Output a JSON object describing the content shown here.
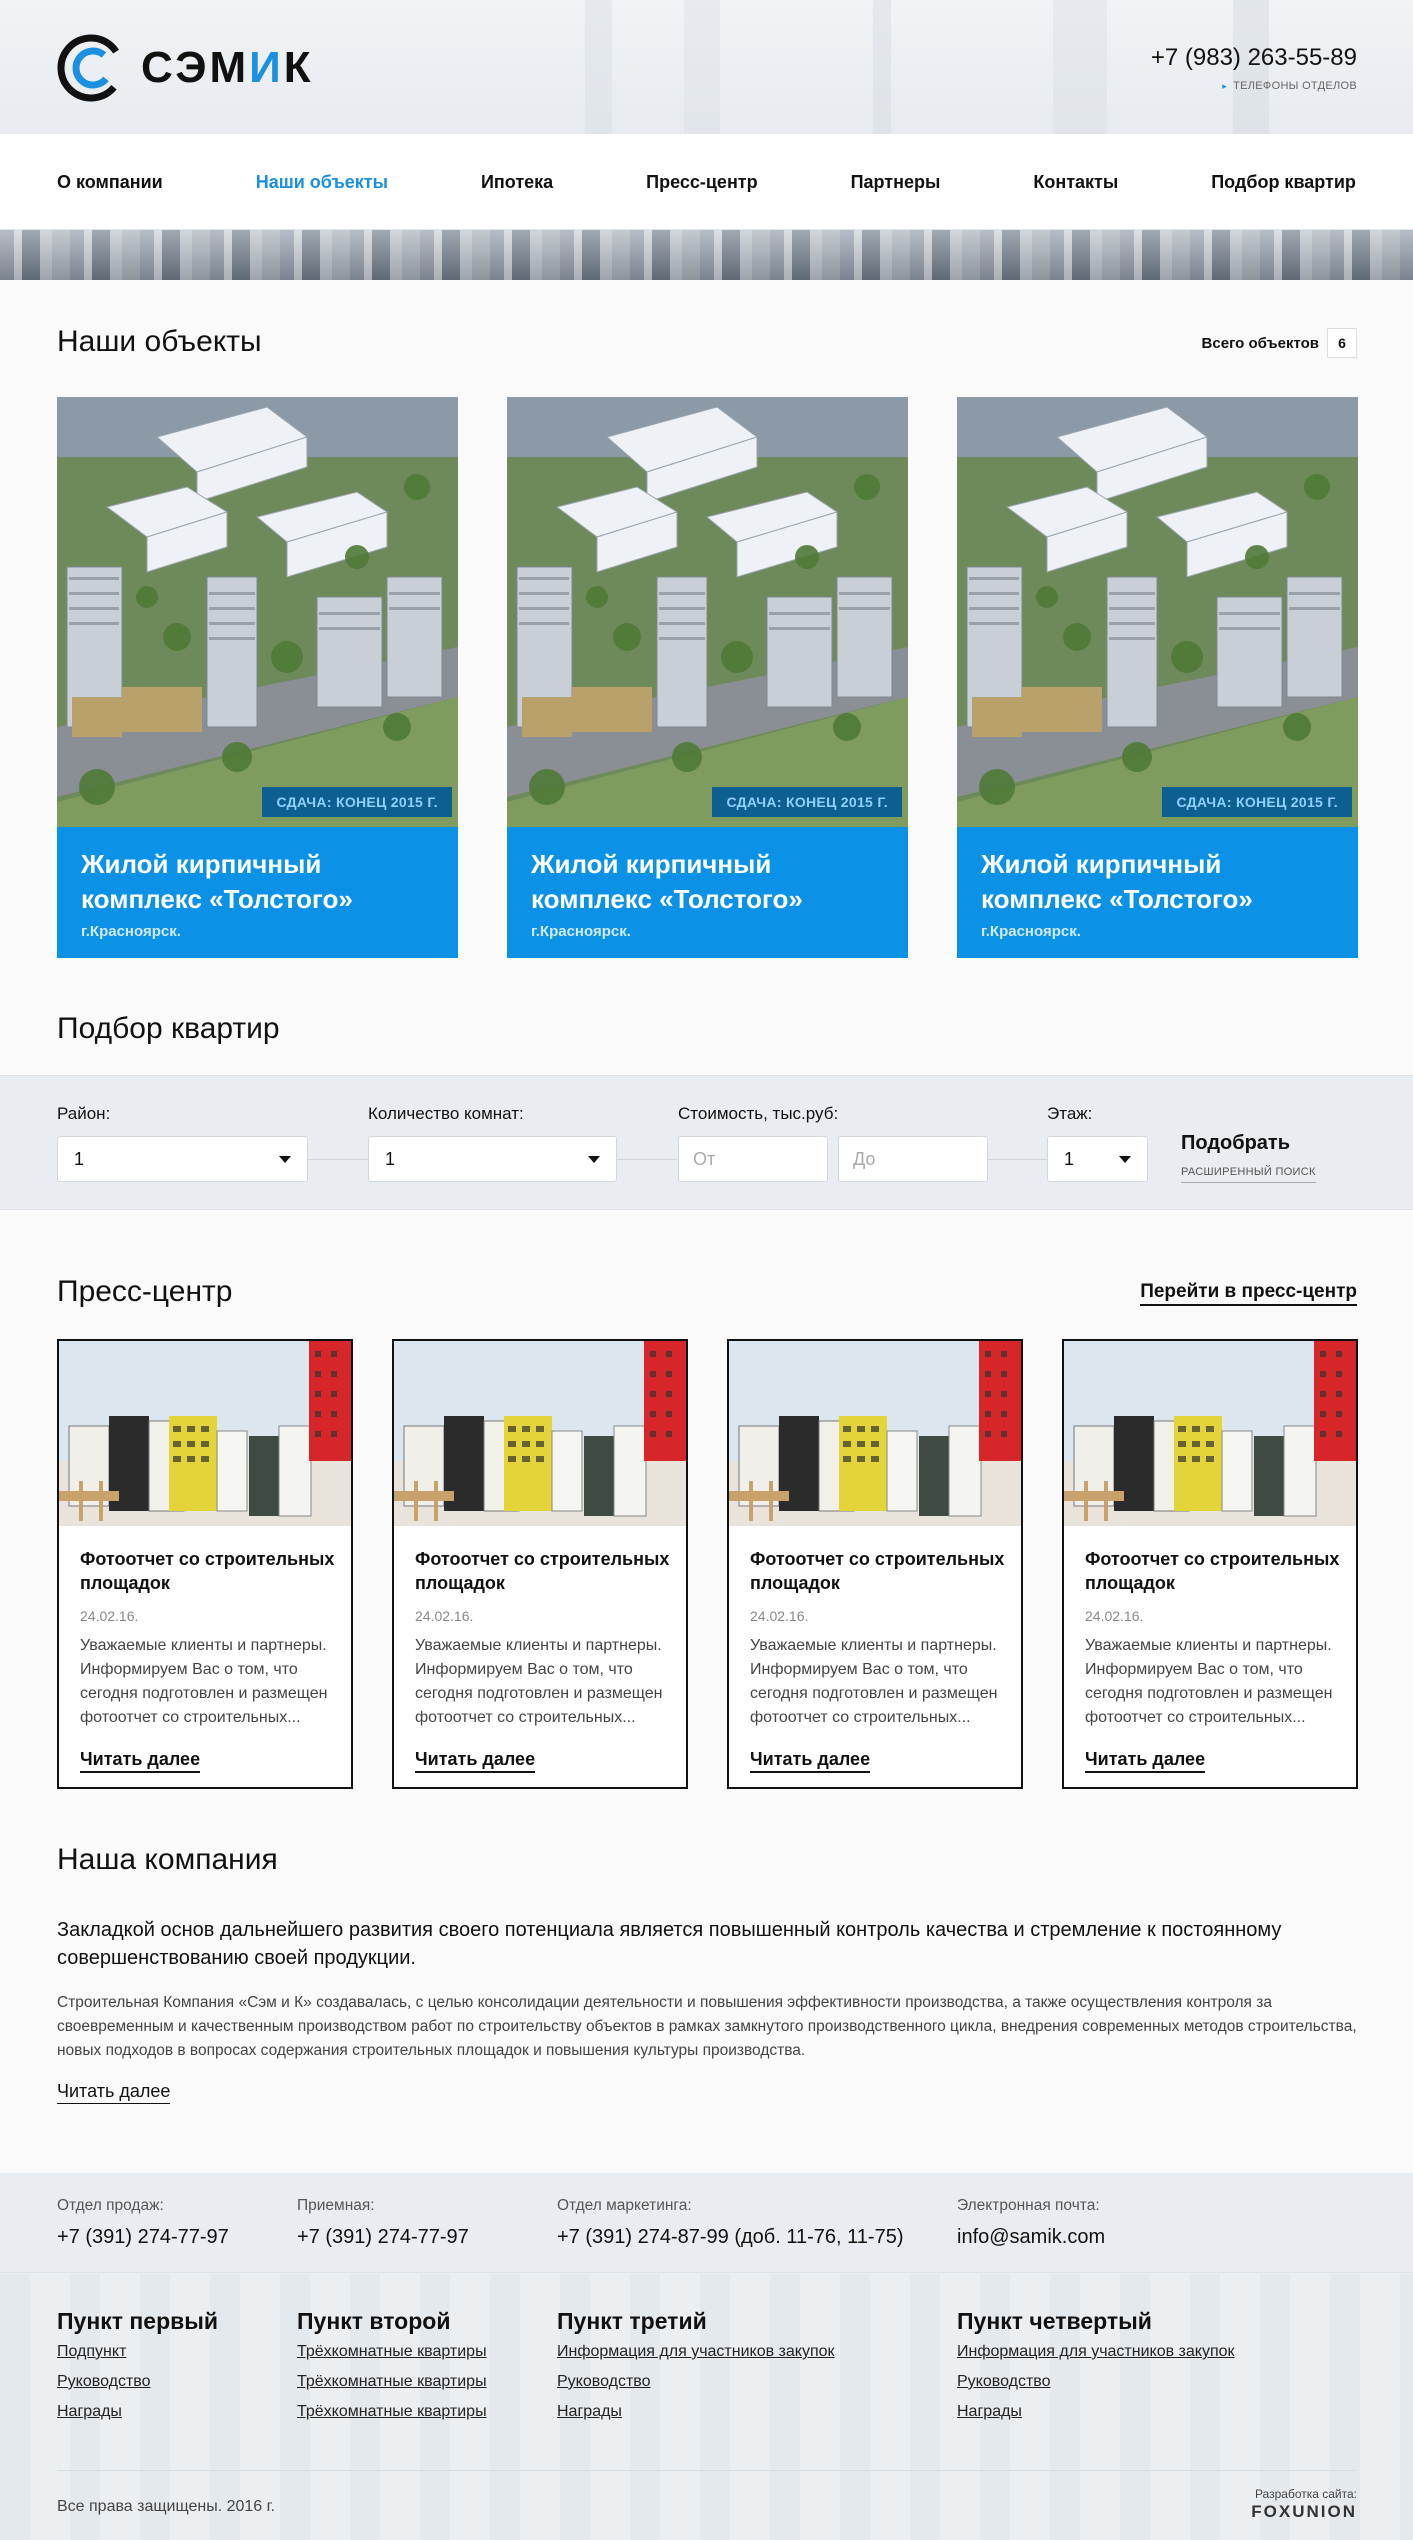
{
  "header": {
    "brand": "СЭМИК",
    "phone": "+7 (983) 263-55-89",
    "phone_sub": "ТЕЛЕФОНЫ ОТДЕЛОВ"
  },
  "nav": {
    "items": [
      {
        "label": "О компании"
      },
      {
        "label": "Наши объекты"
      },
      {
        "label": "Ипотека"
      },
      {
        "label": "Пресс-центр"
      },
      {
        "label": "Партнеры"
      },
      {
        "label": "Контакты"
      },
      {
        "label": "Подбор квартир"
      }
    ],
    "active": "Наши объекты"
  },
  "objects": {
    "title": "Наши объекты",
    "total_label": "Всего объектов",
    "total_count": "6",
    "cards": [
      {
        "badge": "СДАЧА: КОНЕЦ 2015 Г.",
        "title_line1": "Жилой кирпичный",
        "title_line2": "комплекс «Толстого»",
        "city": "г.Красноярск."
      },
      {
        "badge": "СДАЧА: КОНЕЦ 2015 Г.",
        "title_line1": "Жилой кирпичный",
        "title_line2": "комплекс «Толстого»",
        "city": "г.Красноярск."
      },
      {
        "badge": "СДАЧА: КОНЕЦ 2015 Г.",
        "title_line1": "Жилой кирпичный",
        "title_line2": "комплекс «Толстого»",
        "city": "г.Красноярск."
      }
    ]
  },
  "search": {
    "title": "Подбор квартир",
    "district_label": "Район:",
    "district_value": "1",
    "rooms_label": "Количество комнат:",
    "rooms_value": "1",
    "price_label": "Стоимость, тыс.руб:",
    "price_from_placeholder": "От",
    "price_to_placeholder": "До",
    "floor_label": "Этаж:",
    "floor_value": "1",
    "submit": "Подобрать",
    "advanced": "РАСШИРЕННЫЙ ПОИСК"
  },
  "press": {
    "title": "Пресс-центр",
    "link": "Перейти в пресс-центр",
    "items": [
      {
        "title": "Фотоотчет со строительных площадок",
        "date": "24.02.16.",
        "text": "Уважаемые клиенты и партнеры. Информируем Вас о том, что сегодня подготовлен и размещен фотоотчет со строительных...",
        "more": "Читать далее"
      },
      {
        "title": "Фотоотчет со строительных площадок",
        "date": "24.02.16.",
        "text": "Уважаемые клиенты и партнеры. Информируем Вас о том, что сегодня подготовлен и размещен фотоотчет со строительных...",
        "more": "Читать далее"
      },
      {
        "title": "Фотоотчет со строительных площадок",
        "date": "24.02.16.",
        "text": "Уважаемые клиенты и партнеры. Информируем Вас о том, что сегодня подготовлен и размещен фотоотчет со строительных...",
        "more": "Читать далее"
      },
      {
        "title": "Фотоотчет со строительных площадок",
        "date": "24.02.16.",
        "text": "Уважаемые клиенты и партнеры. Информируем Вас о том, что сегодня подготовлен и размещен фотоотчет со строительных...",
        "more": "Читать далее"
      }
    ]
  },
  "company": {
    "title": "Наша компания",
    "lead": "Закладкой основ дальнейшего развития своего потенциала является повышенный контроль качества и стремление к постоянному совершенствованию своей продукции.",
    "text": "Строительная Компания «Сэм и К» создавалась, с целью консолидации деятельности и повышения эффективности производства, а также осуществления контроля за своевременным и качественным производством работ по строительству объектов в рамках замкнутого производственного цикла, внедрения современных методов строительства, новых подходов в вопросах содержания строительных площадок и повышения культуры производства.",
    "more": "Читать далее"
  },
  "footer": {
    "contacts": [
      {
        "label": "Отдел продаж:",
        "value": "+7 (391) 274-77-97"
      },
      {
        "label": "Приемная:",
        "value": "+7 (391) 274-77-97"
      },
      {
        "label": "Отдел маркетинга:",
        "value": "+7 (391) 274-87-99 (доб. 11-76, 11-75)"
      },
      {
        "label": "Электронная почта:",
        "value": "info@samik.com"
      }
    ],
    "columns": [
      {
        "title": "Пункт первый",
        "links": [
          "Подпункт",
          "Руководство",
          "Награды"
        ]
      },
      {
        "title": "Пункт второй",
        "links": [
          "Трёхкомнатные квартиры",
          "Трёхкомнатные квартиры",
          "Трёхкомнатные квартиры"
        ]
      },
      {
        "title": "Пункт третий",
        "links": [
          "Информация для участников закупок",
          "Руководство",
          "Награды"
        ]
      },
      {
        "title": "Пункт четвертый",
        "links": [
          "Информация для участников закупок",
          "Руководство",
          "Награды"
        ]
      }
    ],
    "copyright": "Все права защищены. 2016 г.",
    "dev_label": "Разработка сайта:",
    "dev_name": "FOXUNION"
  },
  "colors": {
    "accent": "#1b8fe0",
    "card_blue": "#0b92e6",
    "badge_bg": "#0d5f92"
  }
}
